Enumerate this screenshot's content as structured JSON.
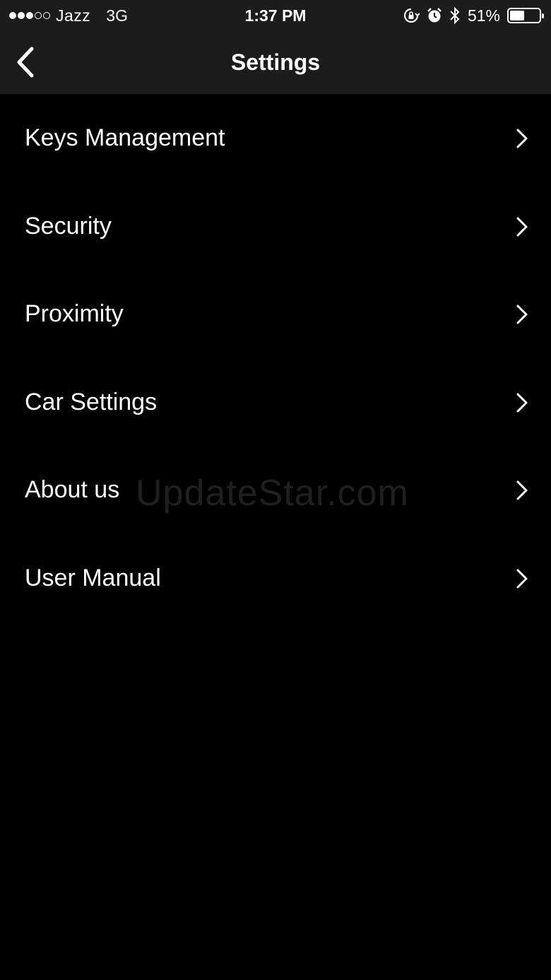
{
  "status_bar": {
    "carrier": "Jazz",
    "network": "3G",
    "time": "1:37 PM",
    "battery_percent": "51%",
    "battery_level": 0.51,
    "signal_full": 3,
    "signal_empty": 2,
    "icons": [
      "orientation-lock-icon",
      "alarm-icon",
      "bluetooth-icon",
      "battery-icon"
    ]
  },
  "nav": {
    "title": "Settings",
    "back_icon": "chevron-left-icon"
  },
  "menu": {
    "items": [
      {
        "label": "Keys Management"
      },
      {
        "label": "Security"
      },
      {
        "label": "Proximity"
      },
      {
        "label": "Car Settings"
      },
      {
        "label": "About us"
      },
      {
        "label": "User Manual"
      }
    ],
    "chevron_icon": "chevron-right-icon"
  },
  "watermark": "UpdateStar.com",
  "colors": {
    "background": "#000000",
    "header": "#1c1c1c",
    "text": "#ffffff"
  }
}
